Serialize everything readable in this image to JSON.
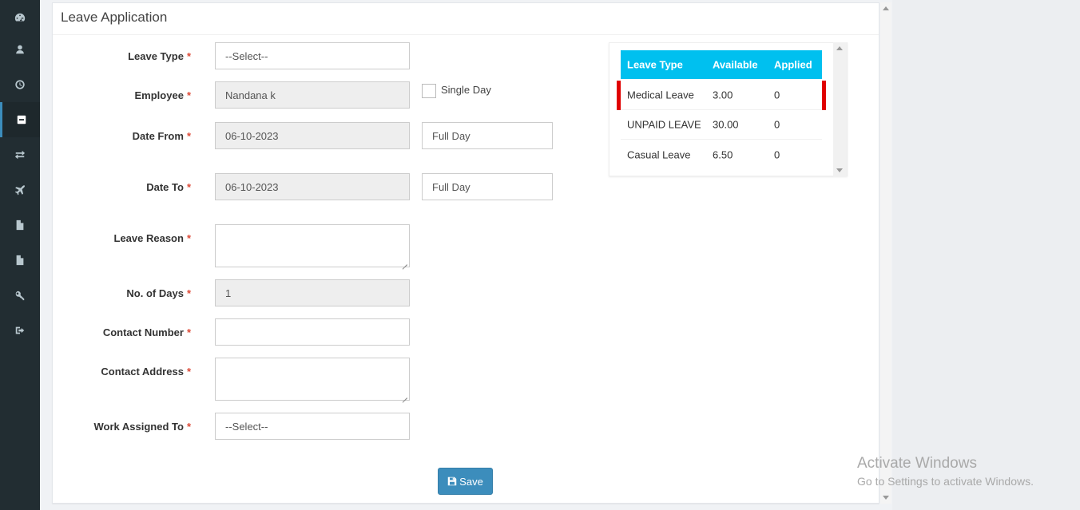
{
  "sidebar": {
    "items": [
      {
        "icon": "dashboard-icon"
      },
      {
        "icon": "user-icon"
      },
      {
        "icon": "clock-icon"
      },
      {
        "icon": "minus-square-icon",
        "active": true
      },
      {
        "icon": "exchange-icon"
      },
      {
        "icon": "plane-icon"
      },
      {
        "icon": "document-icon"
      },
      {
        "icon": "document-icon"
      },
      {
        "icon": "key-icon"
      },
      {
        "icon": "sign-out-icon"
      }
    ]
  },
  "panel": {
    "title": "Leave Application"
  },
  "form": {
    "required_mark": "*",
    "leave_type": {
      "label": "Leave Type",
      "value": "--Select--"
    },
    "employee": {
      "label": "Employee",
      "value": "Nandana k"
    },
    "single_day": {
      "label": "Single Day",
      "checked": false
    },
    "date_from": {
      "label": "Date From",
      "value": "06-10-2023",
      "day_type": "Full Day"
    },
    "date_to": {
      "label": "Date To",
      "value": "06-10-2023",
      "day_type": "Full Day"
    },
    "leave_reason": {
      "label": "Leave Reason",
      "value": ""
    },
    "no_of_days": {
      "label": "No. of Days",
      "value": "1"
    },
    "contact_number": {
      "label": "Contact Number",
      "value": ""
    },
    "contact_address": {
      "label": "Contact Address",
      "value": ""
    },
    "work_assigned_to": {
      "label": "Work Assigned To",
      "value": "--Select--"
    },
    "save_label": "Save"
  },
  "balance_table": {
    "headers": {
      "leave_type": "Leave Type",
      "available": "Available",
      "applied": "Applied"
    },
    "rows": [
      {
        "leave_type": "Medical Leave",
        "available": "3.00",
        "applied": "0"
      },
      {
        "leave_type": "UNPAID LEAVE",
        "available": "30.00",
        "applied": "0"
      },
      {
        "leave_type": "Casual Leave",
        "available": "6.50",
        "applied": "0"
      }
    ],
    "header_color": "#00c0ef",
    "highlight_color": "#e00000"
  },
  "watermark": {
    "title": "Activate Windows",
    "subtitle": "Go to Settings to activate Windows."
  }
}
